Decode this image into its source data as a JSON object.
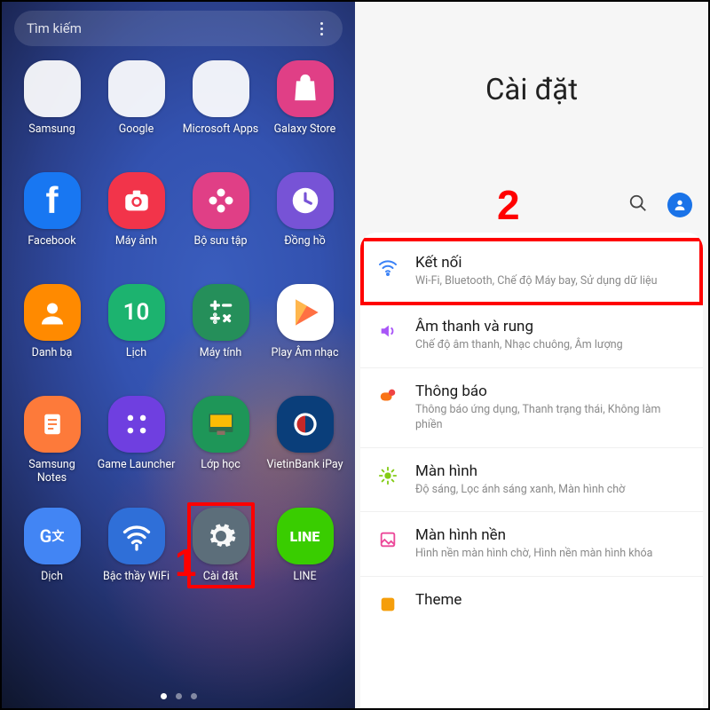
{
  "left": {
    "search_placeholder": "Tìm kiếm",
    "apps": [
      {
        "label": "Samsung",
        "type": "folder",
        "minis": [
          "#1aa3c7",
          "#6b5cc8",
          "#e64a19",
          "#ffb300",
          "#36b37e",
          "#ec407a",
          "#26a69a",
          "#5c6bc0",
          "#9ccc65"
        ]
      },
      {
        "label": "Google",
        "type": "folder",
        "minis": [
          "#4285f4",
          "#ea4335",
          "#fbbc05",
          "#34a853",
          "#f44336",
          "#1a73e8",
          "#ea4335",
          "#424242",
          "#2962ff"
        ]
      },
      {
        "label": "Microsoft Apps",
        "type": "folder",
        "minis": [
          "#424242",
          "#424242",
          "#0078d4",
          "#424242",
          "#424242",
          "#0078d4",
          "#",
          "#",
          ""
        ]
      },
      {
        "label": "Galaxy Store",
        "type": "icon",
        "bg": "#e03f86",
        "svg": "bag"
      },
      {
        "label": "Facebook",
        "type": "icon",
        "bg": "#1877f2",
        "svg": "fb"
      },
      {
        "label": "Máy ảnh",
        "type": "icon",
        "bg": "#f2344a",
        "svg": "camera"
      },
      {
        "label": "Bộ sưu tập",
        "type": "icon",
        "bg": "#e03f86",
        "svg": "flower"
      },
      {
        "label": "Đồng hồ",
        "type": "icon",
        "bg": "#7753d6",
        "svg": "clock"
      },
      {
        "label": "Danh bạ",
        "type": "icon",
        "bg": "#ff8a00",
        "svg": "contact"
      },
      {
        "label": "Lịch",
        "type": "icon",
        "bg": "#1cb36f",
        "svg": "cal",
        "text": "10"
      },
      {
        "label": "Máy tính",
        "type": "icon",
        "bg": "#258f5a",
        "svg": "calc"
      },
      {
        "label": "Play Âm nhạc",
        "type": "icon",
        "bg": "#ffffff",
        "svg": "playmusic"
      },
      {
        "label": "Samsung Notes",
        "type": "icon",
        "bg": "#fd7a3a",
        "svg": "notes"
      },
      {
        "label": "Game Launcher",
        "type": "icon",
        "bg": "#6f3fe0",
        "svg": "game"
      },
      {
        "label": "Lớp học",
        "type": "icon",
        "bg": "#1e9658",
        "svg": "class"
      },
      {
        "label": "VietinBank iPay",
        "type": "icon",
        "bg": "#0a3e7a",
        "svg": "vtb"
      },
      {
        "label": "Dịch",
        "type": "icon",
        "bg": "#4285f4",
        "svg": "translate"
      },
      {
        "label": "Bậc thầy WiFi",
        "type": "icon",
        "bg": "#2f6fd8",
        "svg": "wifim"
      },
      {
        "label": "Cài đặt",
        "type": "icon",
        "bg": "#5c6e7a",
        "svg": "gear",
        "highlight": true
      },
      {
        "label": "LINE",
        "type": "icon",
        "bg": "#39cd00",
        "svg": "line"
      }
    ],
    "step_number_1": "1"
  },
  "right": {
    "title": "Cài đặt",
    "step_number_2": "2",
    "items": [
      {
        "icon": "wifi",
        "color": "#3b82f6",
        "title": "Kết nối",
        "desc": "Wi-Fi, Bluetooth, Chế độ Máy bay, Sử dụng dữ liệu",
        "highlight": true
      },
      {
        "icon": "sound",
        "color": "#a855f7",
        "title": "Âm thanh và rung",
        "desc": "Chế độ âm thanh, Nhạc chuông, Âm lượng"
      },
      {
        "icon": "notif",
        "color": "#f97316",
        "title": "Thông báo",
        "desc": "Thông báo ứng dụng, Thanh trạng thái, Không làm phiền"
      },
      {
        "icon": "display",
        "color": "#84cc16",
        "title": "Màn hình",
        "desc": "Độ sáng, Lọc ánh sáng xanh, Màn hình chờ"
      },
      {
        "icon": "wallpaper",
        "color": "#ec4899",
        "title": "Màn hình nền",
        "desc": "Hình nền màn hình chờ, Hình nền màn hình khóa"
      },
      {
        "icon": "theme",
        "color": "#f59e0b",
        "title": "Theme",
        "desc": ""
      }
    ]
  }
}
